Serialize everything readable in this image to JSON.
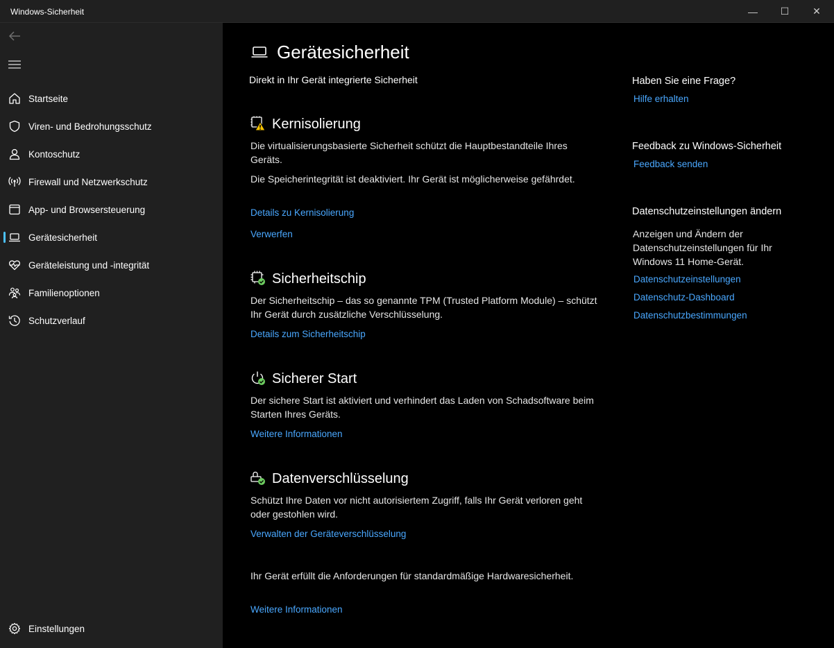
{
  "window": {
    "title": "Windows-Sicherheit",
    "minimize_glyph": "—",
    "maximize_glyph": "☐",
    "close_glyph": "✕"
  },
  "sidebar": {
    "items": [
      {
        "label": "Startseite",
        "icon": "home-icon"
      },
      {
        "label": "Viren- und Bedrohungsschutz",
        "icon": "shield-icon"
      },
      {
        "label": "Kontoschutz",
        "icon": "person-icon"
      },
      {
        "label": "Firewall und Netzwerkschutz",
        "icon": "antenna-icon"
      },
      {
        "label": "App- und Browsersteuerung",
        "icon": "browser-window-icon"
      },
      {
        "label": "Gerätesicherheit",
        "icon": "laptop-icon",
        "selected": true
      },
      {
        "label": "Geräteleistung und -integrität",
        "icon": "heart-pulse-icon"
      },
      {
        "label": "Familienoptionen",
        "icon": "family-icon"
      },
      {
        "label": "Schutzverlauf",
        "icon": "history-icon"
      }
    ],
    "settings_label": "Einstellungen"
  },
  "main": {
    "title": "Gerätesicherheit",
    "subtitle": "Direkt in Ihr Gerät integrierte Sicherheit",
    "core_isolation": {
      "title": "Kernisolierung",
      "text1": "Die virtualisierungsbasierte Sicherheit schützt die Hauptbestandteile Ihres Geräts.",
      "text2": "Die Speicherintegrität ist deaktiviert. Ihr Gerät ist möglicherweise gefährdet.",
      "link_details": "Details zu Kernisolierung",
      "link_dismiss": "Verwerfen"
    },
    "security_chip": {
      "title": "Sicherheitschip",
      "text": "Der Sicherheitschip – das so genannte TPM (Trusted Platform Module) – schützt Ihr Gerät durch zusätzliche Verschlüsselung.",
      "link": "Details zum Sicherheitschip"
    },
    "secure_boot": {
      "title": "Sicherer Start",
      "text": "Der sichere Start ist aktiviert und verhindert das Laden von Schadsoftware beim Starten Ihres Geräts.",
      "link": "Weitere Informationen"
    },
    "encryption": {
      "title": "Datenverschlüsselung",
      "text": "Schützt Ihre Daten vor nicht autorisiertem Zugriff, falls Ihr Gerät verloren geht oder gestohlen wird.",
      "link": "Verwalten der Geräteverschlüsselung"
    },
    "hardware": {
      "text": "Ihr Gerät erfüllt die Anforderungen für standardmäßige Hardwaresicherheit.",
      "link": "Weitere Informationen"
    }
  },
  "aside": {
    "question_head": "Haben Sie eine Frage?",
    "help_link": "Hilfe erhalten",
    "feedback_head": "Feedback zu Windows-Sicherheit",
    "feedback_link": "Feedback senden",
    "privacy_head": "Datenschutzeinstellungen ändern",
    "privacy_text": "Anzeigen und Ändern der Datenschutzeinstellungen für Ihr Windows 11 Home-Gerät.",
    "privacy_links": [
      "Datenschutzeinstellungen",
      "Datenschutz-Dashboard",
      "Datenschutzbestimmungen"
    ]
  },
  "colors": {
    "accent": "#4cc2ff",
    "link": "#4aa8ff",
    "warning": "#f7c300",
    "ok": "#6ccb5f"
  }
}
